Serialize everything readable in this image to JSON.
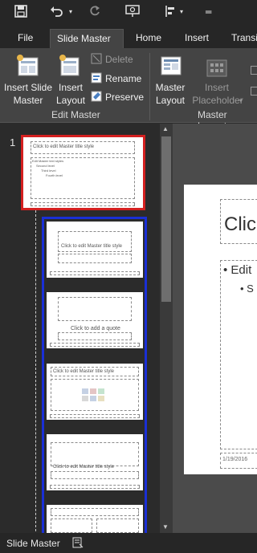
{
  "qat": {
    "save_icon": "save-icon",
    "undo_icon": "undo-icon",
    "redo_icon": "redo-icon",
    "present_icon": "present-icon",
    "layout_icon": "layout-icon",
    "more_icon": "more-icon"
  },
  "tabs": [
    {
      "label": "File"
    },
    {
      "label": "Slide Master"
    },
    {
      "label": "Home"
    },
    {
      "label": "Insert"
    },
    {
      "label": "Transi"
    }
  ],
  "ribbon": {
    "insert_slide_master": "Insert Slide Master",
    "insert_slide_master_l1": "Insert Slide",
    "insert_slide_master_l2": "Master",
    "insert_layout_l1": "Insert",
    "insert_layout_l2": "Layout",
    "delete": "Delete",
    "rename": "Rename",
    "preserve": "Preserve",
    "group_edit_master": "Edit Master",
    "master_layout_l1": "Master",
    "master_layout_l2": "Layout",
    "insert_placeholder_l1": "Insert",
    "insert_placeholder_l2": "Placeholder",
    "group_master_layout": "Master Layout"
  },
  "thumbnails": {
    "slide_number": "1",
    "master_title": "Click to edit Master title style",
    "master_text_1": "Edit Master text styles",
    "master_text_2": "Second level",
    "master_text_3": "Third level",
    "master_text_4": "Fourth level",
    "layout1_title": "Click to edit Master title style",
    "layout2_quote": "Click to add a quote",
    "layout3_title": "Click to edit Master title style",
    "layout4_title": "Click to edit Master title style"
  },
  "editor": {
    "title_partial": "Clic",
    "bullet1": "Edit",
    "bullet2": "S",
    "date": "1/19/2016"
  },
  "status": {
    "label": "Slide Master"
  },
  "colors": {
    "selected_master": "#d42020",
    "selected_layouts": "#1a2fd6"
  }
}
